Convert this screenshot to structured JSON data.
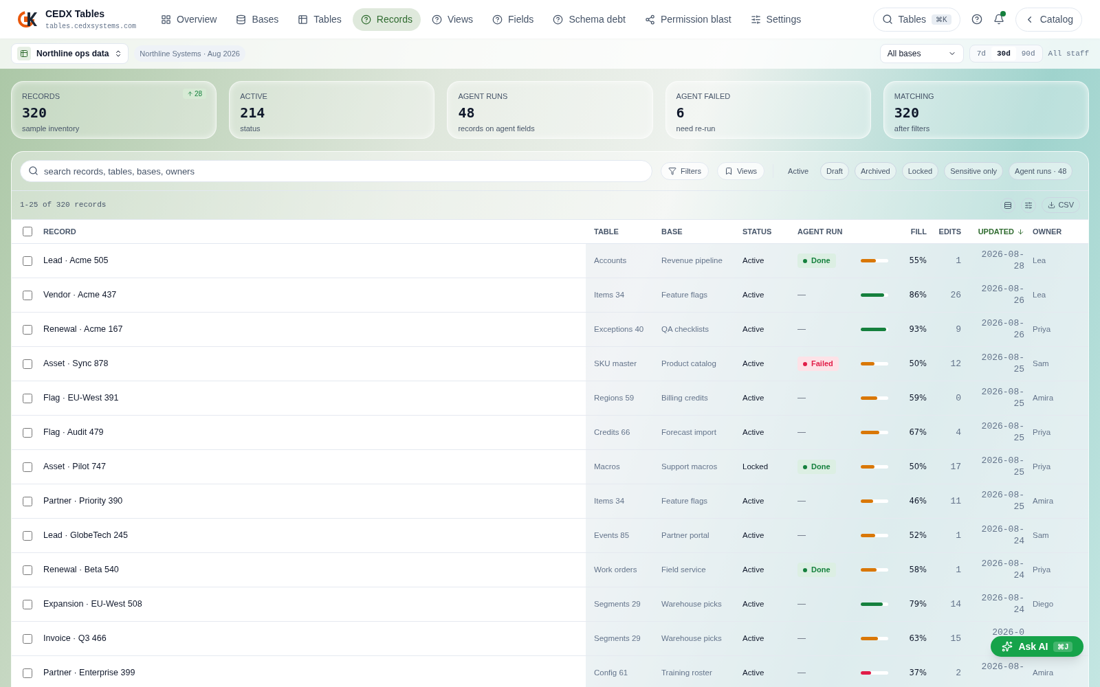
{
  "brand": {
    "name": "CEDX Tables",
    "domain": "tables.cedxsystems.com"
  },
  "nav": [
    {
      "label": "Overview",
      "selected": false
    },
    {
      "label": "Bases",
      "selected": false
    },
    {
      "label": "Tables",
      "selected": false
    },
    {
      "label": "Records",
      "selected": true
    },
    {
      "label": "Views",
      "selected": false
    },
    {
      "label": "Fields",
      "selected": false
    },
    {
      "label": "Schema debt",
      "selected": false
    },
    {
      "label": "Permission blast",
      "selected": false
    },
    {
      "label": "Settings",
      "selected": false
    }
  ],
  "search_button": {
    "label": "Tables",
    "shortcut": "⌘K"
  },
  "notifications": {
    "unread": true
  },
  "back_button": {
    "label": "Catalog"
  },
  "workspace": {
    "name": "Northline ops data",
    "context": "Northline Systems · Aug 2026"
  },
  "base_select": {
    "value": "All bases"
  },
  "ranges": [
    {
      "label": "7d",
      "selected": false
    },
    {
      "label": "30d",
      "selected": true
    },
    {
      "label": "90d",
      "selected": false
    }
  ],
  "scope": "All staff",
  "stats": [
    {
      "label": "RECORDS",
      "value": "320",
      "note": "sample inventory",
      "delta": "28"
    },
    {
      "label": "ACTIVE",
      "value": "214",
      "note": "status"
    },
    {
      "label": "AGENT RUNS",
      "value": "48",
      "note": "records on agent fields"
    },
    {
      "label": "AGENT FAILED",
      "value": "6",
      "note": "need re-run"
    },
    {
      "label": "MATCHING",
      "value": "320",
      "note": "after filters"
    }
  ],
  "search": {
    "placeholder": "search records, tables, bases, owners"
  },
  "filter_buttons": [
    "Filters",
    "Views"
  ],
  "chips": [
    {
      "label": "Active",
      "selected": true
    },
    {
      "label": "Draft",
      "selected": false
    },
    {
      "label": "Archived",
      "selected": false
    },
    {
      "label": "Locked",
      "selected": false
    },
    {
      "label": "Sensitive only",
      "selected": false
    },
    {
      "label": "Agent runs · 48",
      "selected": false
    }
  ],
  "count": "1-25 of 320 records",
  "csv_button": "CSV",
  "columns": [
    "RECORD",
    "TABLE",
    "BASE",
    "STATUS",
    "AGENT RUN",
    "FILL",
    "EDITS",
    "UPDATED",
    "OWNER"
  ],
  "select_all": {
    "checked": false
  },
  "rows": [
    {
      "record": "Lead · Acme 505",
      "table": "Accounts",
      "base": "Revenue pipeline",
      "status": "Active",
      "agent": {
        "kind": "done",
        "label": "Done"
      },
      "level": 0.55,
      "fill": "55%",
      "edits": "1",
      "updated": "2026-08-28",
      "owner": "Lea",
      "checked": false
    },
    {
      "record": "Vendor · Acme 437",
      "table": "Items 34",
      "base": "Feature flags",
      "status": "Active",
      "agent": {
        "kind": "none",
        "label": "—"
      },
      "level": 0.86,
      "fill": "86%",
      "edits": "26",
      "updated": "2026-08-26",
      "owner": "Lea",
      "checked": false
    },
    {
      "record": "Renewal · Acme 167",
      "table": "Exceptions 40",
      "base": "QA checklists",
      "status": "Active",
      "agent": {
        "kind": "none",
        "label": "—"
      },
      "level": 0.93,
      "fill": "93%",
      "edits": "9",
      "updated": "2026-08-26",
      "owner": "Priya",
      "checked": false
    },
    {
      "record": "Asset · Sync 878",
      "table": "SKU master",
      "base": "Product catalog",
      "status": "Active",
      "agent": {
        "kind": "failed",
        "label": "Failed"
      },
      "level": 0.5,
      "fill": "50%",
      "edits": "12",
      "updated": "2026-08-25",
      "owner": "Sam",
      "checked": false
    },
    {
      "record": "Flag · EU-West 391",
      "table": "Regions 59",
      "base": "Billing credits",
      "status": "Active",
      "agent": {
        "kind": "none",
        "label": "—"
      },
      "level": 0.59,
      "fill": "59%",
      "edits": "0",
      "updated": "2026-08-25",
      "owner": "Amira",
      "checked": false
    },
    {
      "record": "Flag · Audit 479",
      "table": "Credits 66",
      "base": "Forecast import",
      "status": "Active",
      "agent": {
        "kind": "none",
        "label": "—"
      },
      "level": 0.67,
      "fill": "67%",
      "edits": "4",
      "updated": "2026-08-25",
      "owner": "Priya",
      "checked": false
    },
    {
      "record": "Asset · Pilot 747",
      "table": "Macros",
      "base": "Support macros",
      "status": "Locked",
      "agent": {
        "kind": "done",
        "label": "Done"
      },
      "level": 0.5,
      "fill": "50%",
      "edits": "17",
      "updated": "2026-08-25",
      "owner": "Priya",
      "checked": false
    },
    {
      "record": "Partner · Priority 390",
      "table": "Items 34",
      "base": "Feature flags",
      "status": "Active",
      "agent": {
        "kind": "none",
        "label": "—"
      },
      "level": 0.46,
      "fill": "46%",
      "edits": "11",
      "updated": "2026-08-25",
      "owner": "Amira",
      "checked": false
    },
    {
      "record": "Lead · GlobeTech 245",
      "table": "Events 85",
      "base": "Partner portal",
      "status": "Active",
      "agent": {
        "kind": "none",
        "label": "—"
      },
      "level": 0.52,
      "fill": "52%",
      "edits": "1",
      "updated": "2026-08-24",
      "owner": "Sam",
      "checked": false
    },
    {
      "record": "Renewal · Beta 540",
      "table": "Work orders",
      "base": "Field service",
      "status": "Active",
      "agent": {
        "kind": "done",
        "label": "Done"
      },
      "level": 0.58,
      "fill": "58%",
      "edits": "1",
      "updated": "2026-08-24",
      "owner": "Priya",
      "checked": false
    },
    {
      "record": "Expansion · EU-West 508",
      "table": "Segments 29",
      "base": "Warehouse picks",
      "status": "Active",
      "agent": {
        "kind": "none",
        "label": "—"
      },
      "level": 0.79,
      "fill": "79%",
      "edits": "14",
      "updated": "2026-08-24",
      "owner": "Diego",
      "checked": false
    },
    {
      "record": "Invoice · Q3 466",
      "table": "Segments 29",
      "base": "Warehouse picks",
      "status": "Active",
      "agent": {
        "kind": "none",
        "label": "—"
      },
      "level": 0.63,
      "fill": "63%",
      "edits": "15",
      "updated": "2026-0",
      "owner": "",
      "checked": false
    },
    {
      "record": "Partner · Enterprise 399",
      "table": "Config 61",
      "base": "Training roster",
      "status": "Active",
      "agent": {
        "kind": "none",
        "label": "—"
      },
      "level": 0.37,
      "fill": "37%",
      "edits": "2",
      "updated": "2026-08-",
      "owner": "Amira",
      "checked": false
    }
  ],
  "ask_ai": {
    "label": "Ask AI",
    "shortcut": "⌘J"
  }
}
